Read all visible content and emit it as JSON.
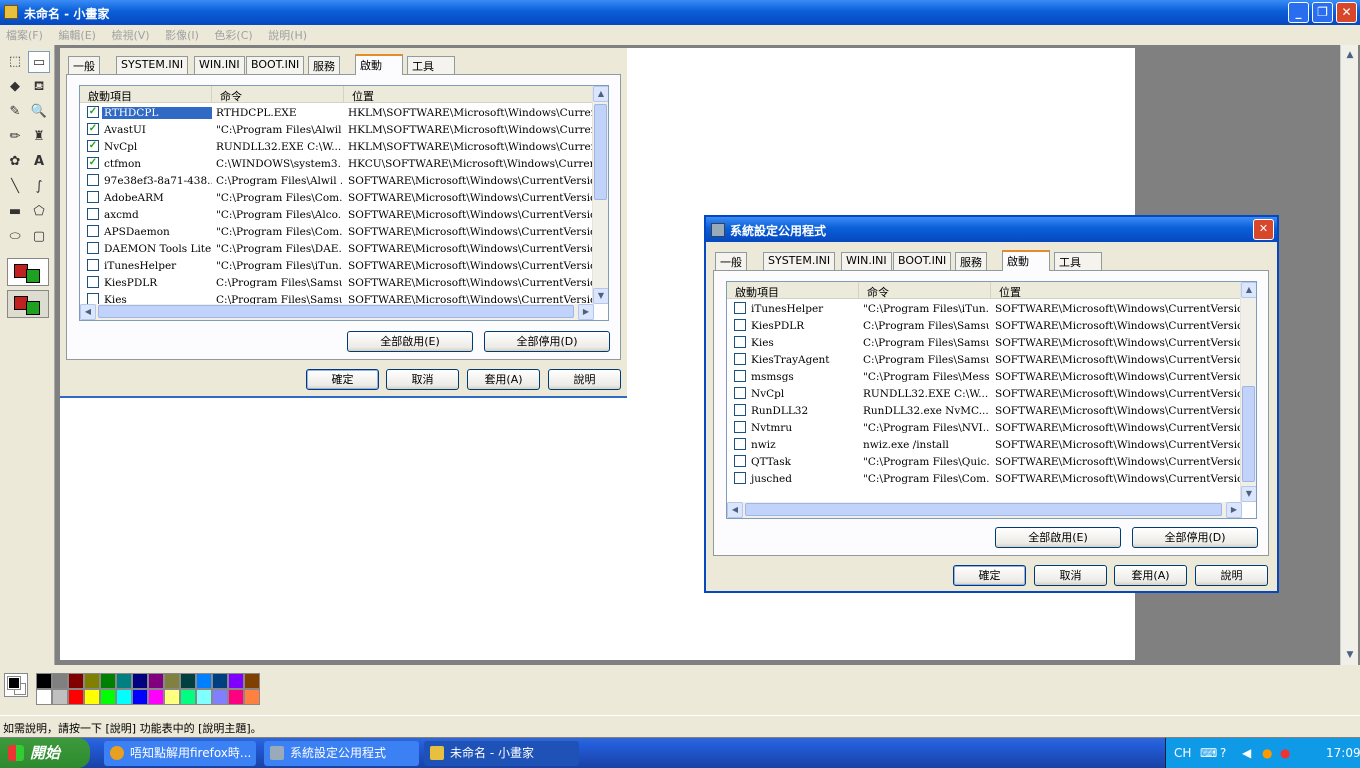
{
  "app": {
    "title": "未命名 - 小畫家",
    "menu": [
      "檔案(F)",
      "編輯(E)",
      "檢視(V)",
      "影像(I)",
      "色彩(C)",
      "說明(H)"
    ],
    "window_buttons": {
      "minimize": "_",
      "restore": "❐",
      "close": "✕"
    }
  },
  "tools": {
    "icons": [
      "free-select-icon",
      "rect-select-icon",
      "eraser-icon",
      "fill-icon",
      "picker-icon",
      "magnifier-icon",
      "pencil-icon",
      "brush-icon",
      "airbrush-icon",
      "text-icon",
      "line-icon",
      "curve-icon",
      "rectangle-icon",
      "polygon-icon",
      "ellipse-icon",
      "rounded-rect-icon"
    ],
    "glyphs": [
      "⬚",
      "▭",
      "◆",
      "⛾",
      "✎",
      "🔍",
      "✏",
      "♜",
      "✿",
      "A",
      "╲",
      "∫",
      "▬",
      "⬠",
      "⬭",
      "▢"
    ]
  },
  "palette": {
    "row1": [
      "#000000",
      "#808080",
      "#800000",
      "#808000",
      "#008000",
      "#008080",
      "#000080",
      "#800080",
      "#808040",
      "#004040",
      "#0080ff",
      "#004080",
      "#8000ff",
      "#804000"
    ],
    "row2": [
      "#ffffff",
      "#c0c0c0",
      "#ff0000",
      "#ffff00",
      "#00ff00",
      "#00ffff",
      "#0000ff",
      "#ff00ff",
      "#ffff80",
      "#00ff80",
      "#80ffff",
      "#8080ff",
      "#ff0080",
      "#ff8040"
    ]
  },
  "status": {
    "text": "如需說明，請按一下 [說明] 功能表中的 [說明主題]。"
  },
  "msconfig_bg": {
    "tabs": [
      "一般",
      "SYSTEM.INI",
      "WIN.INI",
      "BOOT.INI",
      "服務",
      "啟動",
      "工具"
    ],
    "active_tab": "啟動",
    "columns": [
      "啟動項目",
      "命令",
      "位置"
    ],
    "rows": [
      {
        "checked": true,
        "name": "RTHDCPL",
        "command": "RTHDCPL.EXE",
        "location": "HKLM\\SOFTWARE\\Microsoft\\Windows\\CurrentV...",
        "selected": true
      },
      {
        "checked": true,
        "name": "AvastUI",
        "command": "\"C:\\Program Files\\Alwil...",
        "location": "HKLM\\SOFTWARE\\Microsoft\\Windows\\CurrentV..."
      },
      {
        "checked": true,
        "name": "NvCpl",
        "command": "RUNDLL32.EXE C:\\W...",
        "location": "HKLM\\SOFTWARE\\Microsoft\\Windows\\CurrentV..."
      },
      {
        "checked": true,
        "name": "ctfmon",
        "command": "C:\\WINDOWS\\system3...",
        "location": "HKCU\\SOFTWARE\\Microsoft\\Windows\\CurrentVe"
      },
      {
        "checked": false,
        "name": "97e38ef3-8a71-438...",
        "command": "C:\\Program Files\\Alwil ...",
        "location": "SOFTWARE\\Microsoft\\Windows\\CurrentVersion\\R"
      },
      {
        "checked": false,
        "name": "AdobeARM",
        "command": "\"C:\\Program Files\\Com...",
        "location": "SOFTWARE\\Microsoft\\Windows\\CurrentVersion\\R"
      },
      {
        "checked": false,
        "name": "axcmd",
        "command": "\"C:\\Program Files\\Alco...",
        "location": "SOFTWARE\\Microsoft\\Windows\\CurrentVersion\\R"
      },
      {
        "checked": false,
        "name": "APSDaemon",
        "command": "\"C:\\Program Files\\Com...",
        "location": "SOFTWARE\\Microsoft\\Windows\\CurrentVersion\\R"
      },
      {
        "checked": false,
        "name": "DAEMON Tools Lite",
        "command": "\"C:\\Program Files\\DAE...",
        "location": "SOFTWARE\\Microsoft\\Windows\\CurrentVersion\\R"
      },
      {
        "checked": false,
        "name": "iTunesHelper",
        "command": "\"C:\\Program Files\\iTun...",
        "location": "SOFTWARE\\Microsoft\\Windows\\CurrentVersion\\R"
      },
      {
        "checked": false,
        "name": "KiesPDLR",
        "command": "C:\\Program Files\\Samsu...",
        "location": "SOFTWARE\\Microsoft\\Windows\\CurrentVersion\\R"
      },
      {
        "checked": false,
        "name": "Kies",
        "command": "C:\\Program Files\\Samsu...",
        "location": "SOFTWARE\\Microsoft\\Windows\\CurrentVersion\\R"
      }
    ],
    "enable_all": "全部啟用(E)",
    "disable_all": "全部停用(D)",
    "ok": "確定",
    "cancel": "取消",
    "apply": "套用(A)",
    "help": "說明"
  },
  "msconfig_fg": {
    "title": "系統設定公用程式",
    "tabs": [
      "一般",
      "SYSTEM.INI",
      "WIN.INI",
      "BOOT.INI",
      "服務",
      "啟動",
      "工具"
    ],
    "active_tab": "啟動",
    "columns": [
      "啟動項目",
      "命令",
      "位置"
    ],
    "rows": [
      {
        "checked": false,
        "name": "iTunesHelper",
        "command": "\"C:\\Program Files\\iTun...",
        "location": "SOFTWARE\\Microsoft\\Windows\\CurrentVersion\\R"
      },
      {
        "checked": false,
        "name": "KiesPDLR",
        "command": "C:\\Program Files\\Samsu...",
        "location": "SOFTWARE\\Microsoft\\Windows\\CurrentVersion\\R"
      },
      {
        "checked": false,
        "name": "Kies",
        "command": "C:\\Program Files\\Samsu...",
        "location": "SOFTWARE\\Microsoft\\Windows\\CurrentVersion\\R"
      },
      {
        "checked": false,
        "name": "KiesTrayAgent",
        "command": "C:\\Program Files\\Samsu...",
        "location": "SOFTWARE\\Microsoft\\Windows\\CurrentVersion\\R"
      },
      {
        "checked": false,
        "name": "msmsgs",
        "command": "\"C:\\Program Files\\Mess...",
        "location": "SOFTWARE\\Microsoft\\Windows\\CurrentVersion\\R"
      },
      {
        "checked": false,
        "name": "NvCpl",
        "command": "RUNDLL32.EXE C:\\W...",
        "location": "SOFTWARE\\Microsoft\\Windows\\CurrentVersion\\R"
      },
      {
        "checked": false,
        "name": "RunDLL32",
        "command": "RunDLL32.exe NvMC...",
        "location": "SOFTWARE\\Microsoft\\Windows\\CurrentVersion\\R"
      },
      {
        "checked": false,
        "name": "Nvtmru",
        "command": "\"C:\\Program Files\\NVI...",
        "location": "SOFTWARE\\Microsoft\\Windows\\CurrentVersion\\R"
      },
      {
        "checked": false,
        "name": "nwiz",
        "command": "nwiz.exe /install",
        "location": "SOFTWARE\\Microsoft\\Windows\\CurrentVersion\\R"
      },
      {
        "checked": false,
        "name": "QTTask",
        "command": "\"C:\\Program Files\\Quic...",
        "location": "SOFTWARE\\Microsoft\\Windows\\CurrentVersion\\R"
      },
      {
        "checked": false,
        "name": "jusched",
        "command": "\"C:\\Program Files\\Com...",
        "location": "SOFTWARE\\Microsoft\\Windows\\CurrentVersion\\R"
      }
    ],
    "enable_all": "全部啟用(E)",
    "disable_all": "全部停用(D)",
    "ok": "確定",
    "cancel": "取消",
    "apply": "套用(A)",
    "help": "說明"
  },
  "taskbar": {
    "start": "開始",
    "items": [
      {
        "label": "唔知點解用firefox時...",
        "icon": "chrome-icon",
        "color": "#e8a020"
      },
      {
        "label": "系統設定公用程式",
        "icon": "msconfig-icon",
        "color": "#9ab"
      },
      {
        "label": "未命名 - 小畫家",
        "icon": "paint-icon",
        "color": "#e8c040"
      }
    ],
    "lang": "CH",
    "clock": "17:09"
  }
}
